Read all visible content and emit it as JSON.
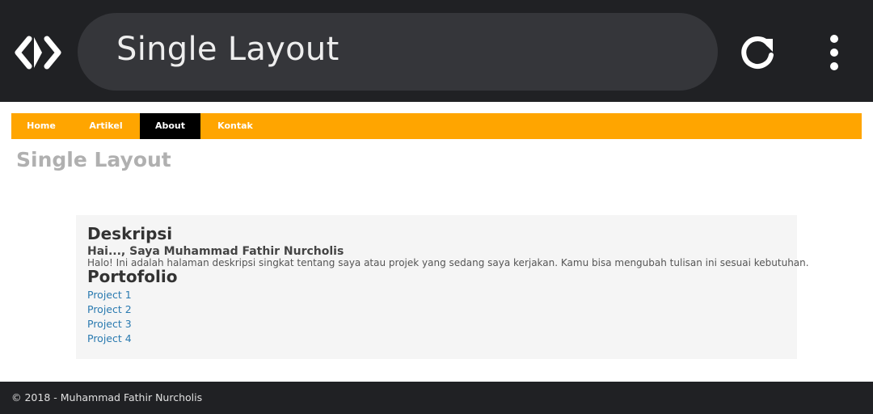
{
  "browser": {
    "title": "Single Layout",
    "logo_icon": "code-brackets-icon",
    "reload_icon": "reload-icon",
    "menu_icon": "more-vert-icon"
  },
  "nav": {
    "items": [
      {
        "label": "Home"
      },
      {
        "label": "Artikel"
      },
      {
        "label": "About",
        "active": true
      },
      {
        "label": "Kontak"
      }
    ],
    "bar_color": "#ffa500",
    "active_color": "#000000"
  },
  "page": {
    "title": "Single Layout"
  },
  "content": {
    "description_heading": "Deskripsi",
    "greeting": "Hai..., Saya Muhammad Fathir Nurcholis",
    "description_text": "Halo! Ini adalah halaman deskripsi singkat tentang saya atau projek yang sedang saya kerjakan. Kamu bisa mengubah tulisan ini sesuai kebutuhan.",
    "portfolio_heading": "Portofolio",
    "projects": [
      {
        "label": "Project 1"
      },
      {
        "label": "Project 2"
      },
      {
        "label": "Project 3"
      },
      {
        "label": "Project 4"
      }
    ],
    "link_color": "#2a7ab0"
  },
  "footer": {
    "text": "© 2018 - Muhammad Fathir Nurcholis"
  }
}
